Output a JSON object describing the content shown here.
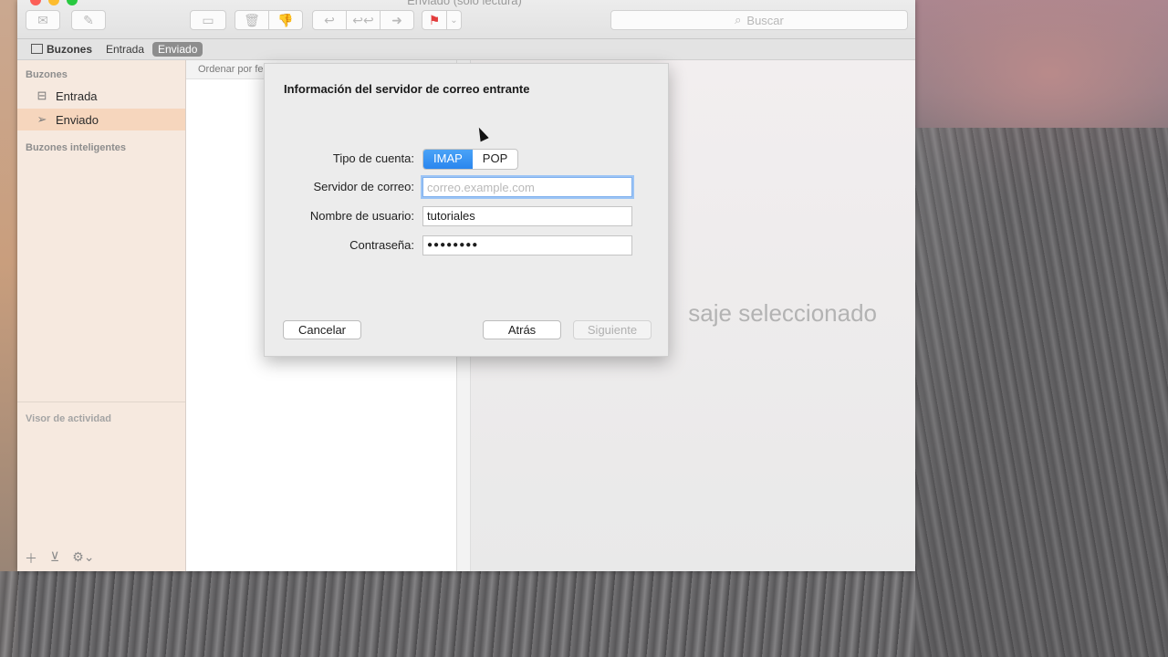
{
  "window": {
    "title": "Enviado (solo lectura)"
  },
  "toolbar": {
    "search_placeholder": "Buscar"
  },
  "favorites": {
    "mailboxes_label": "Buzones",
    "inbox_label": "Entrada",
    "sent_label": "Enviado"
  },
  "sidebar": {
    "section_mailboxes": "Buzones",
    "items": [
      {
        "label": "Entrada",
        "icon": "inbox-tray-icon"
      },
      {
        "label": "Enviado",
        "icon": "paper-plane-icon"
      }
    ],
    "section_smart": "Buzones inteligentes",
    "section_activity": "Visor de actividad"
  },
  "message_list": {
    "sort_label": "Ordenar por fe"
  },
  "viewer": {
    "no_selection_text": "saje seleccionado"
  },
  "dialog": {
    "title": "Información del servidor de correo entrante",
    "account_type_label": "Tipo de cuenta:",
    "account_type_options": [
      "IMAP",
      "POP"
    ],
    "account_type_selected": "IMAP",
    "mail_server_label": "Servidor de correo:",
    "mail_server_value": "",
    "mail_server_placeholder": "correo.example.com",
    "username_label": "Nombre de usuario:",
    "username_value": "tutoriales",
    "password_label": "Contraseña:",
    "password_value": "●●●●●●●●",
    "cancel_label": "Cancelar",
    "back_label": "Atrás",
    "next_label": "Siguiente"
  },
  "colors": {
    "accent": "#2a86ee",
    "sidebar_bg": "#f6e9df",
    "sidebar_selected": "#f6d6bd",
    "flag": "#e23b3b"
  }
}
